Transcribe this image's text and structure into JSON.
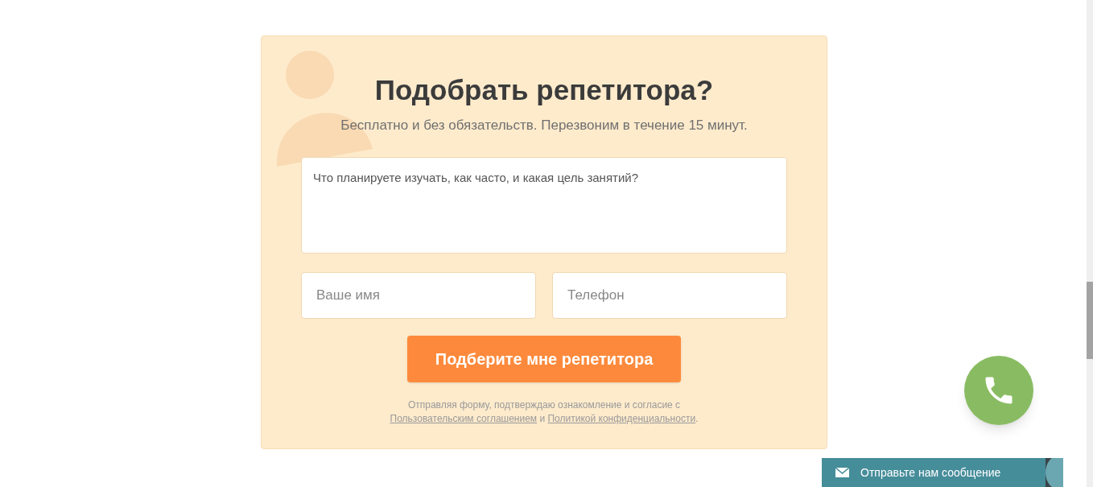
{
  "form": {
    "title": "Подобрать репетитора?",
    "subtitle": "Бесплатно и без обязательств. Перезвоним в течение 15 минут.",
    "goals_field": {
      "placeholder": "Что планируете изучать, как часто, и какая цель занятий?"
    },
    "name_field": {
      "placeholder": "Ваше имя"
    },
    "phone_field": {
      "placeholder": "Телефон"
    },
    "submit_button": "Подберите мне репетитора",
    "consent": [
      {
        "kind": "text",
        "text": "Отправляя форму, подтверждаю ознакомление и согласие с "
      },
      {
        "kind": "link",
        "text": "Пользовательским соглашением"
      },
      {
        "kind": "text",
        "text": " и "
      },
      {
        "kind": "link",
        "text": "Политикой конфиденциальности"
      },
      {
        "kind": "text",
        "text": "."
      }
    ]
  },
  "chat_bar": {
    "label": "Отправьте нам сообщение"
  }
}
